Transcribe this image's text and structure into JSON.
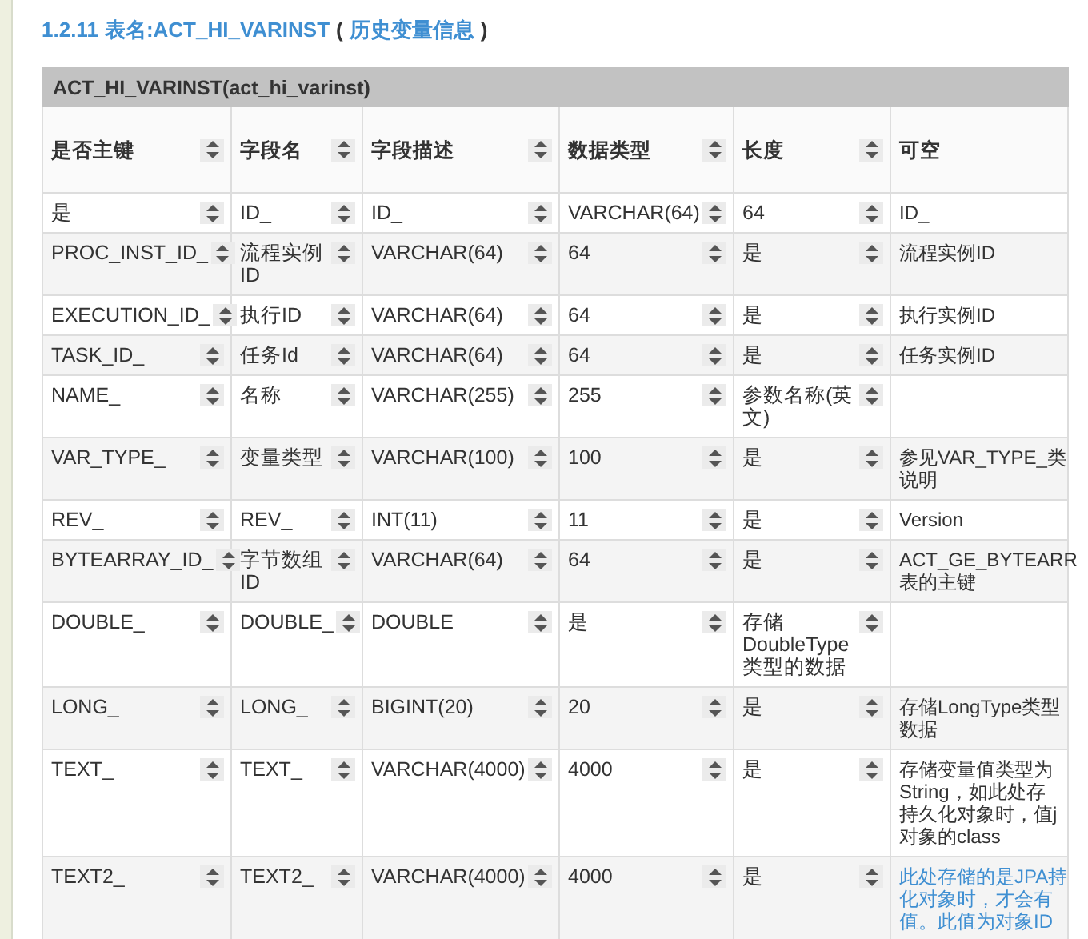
{
  "heading": {
    "number": "1.2.11",
    "label": "表名:ACT_HI_VARINST",
    "open": "(",
    "note": "历史变量信息",
    "close": ")"
  },
  "table": {
    "caption": "ACT_HI_VARINST(act_hi_varinst)",
    "columns": [
      "是否主键",
      "字段名",
      "字段描述",
      "数据类型",
      "长度",
      "可空"
    ],
    "rows": [
      {
        "cells": [
          "是",
          "ID_",
          "ID_",
          "VARCHAR(64)",
          "64"
        ],
        "last": {
          "kind": "text",
          "lines": [
            "ID_"
          ]
        }
      },
      {
        "cells": [
          "PROC_INST_ID_",
          "流程实例ID",
          "VARCHAR(64)",
          "64",
          "是"
        ],
        "last": {
          "kind": "text",
          "lines": [
            "流程实例ID"
          ]
        }
      },
      {
        "cells": [
          "EXECUTION_ID_",
          "执行ID",
          "VARCHAR(64)",
          "64",
          "是"
        ],
        "last": {
          "kind": "text",
          "lines": [
            "执行实例ID"
          ]
        }
      },
      {
        "cells": [
          "TASK_ID_",
          "任务Id",
          "VARCHAR(64)",
          "64",
          "是"
        ],
        "last": {
          "kind": "text",
          "lines": [
            "任务实例ID"
          ]
        }
      },
      {
        "cells": [
          "NAME_",
          "名称",
          "VARCHAR(255)",
          "255",
          "参数名称(英文)"
        ]
      },
      {
        "cells": [
          "VAR_TYPE_",
          "变量类型",
          "VARCHAR(100)",
          "100",
          "是"
        ],
        "last": {
          "kind": "text",
          "lines": [
            "参见VAR_TYPE_类",
            "说明"
          ]
        }
      },
      {
        "cells": [
          "REV_",
          "REV_",
          "INT(11)",
          "11",
          "是"
        ],
        "last": {
          "kind": "text",
          "lines": [
            "Version"
          ]
        }
      },
      {
        "cells": [
          "BYTEARRAY_ID_",
          "字节数组ID",
          "VARCHAR(64)",
          "64",
          "是"
        ],
        "last": {
          "kind": "text",
          "lines": [
            "ACT_GE_BYTEARR",
            "表的主键"
          ]
        }
      },
      {
        "cells": [
          "DOUBLE_",
          "DOUBLE_",
          "DOUBLE",
          "是",
          "存储DoubleType类型的数据"
        ]
      },
      {
        "cells": [
          "LONG_",
          "LONG_",
          "BIGINT(20)",
          "20",
          "是"
        ],
        "last": {
          "kind": "text",
          "lines": [
            "存储LongType类型",
            "数据"
          ]
        }
      },
      {
        "cells": [
          "TEXT_",
          "TEXT_",
          "VARCHAR(4000)",
          "4000",
          "是"
        ],
        "last": {
          "kind": "text",
          "lines": [
            "存储变量值类型为",
            "String，如此处存",
            "持久化对象时，值j",
            "对象的class"
          ]
        }
      },
      {
        "cells": [
          "TEXT2_",
          "TEXT2_",
          "VARCHAR(4000)",
          "4000",
          "是"
        ],
        "last": {
          "kind": "link",
          "lines": [
            "此处存储的是JPA持",
            "化对象时，才会有",
            "值。此值为对象ID"
          ]
        }
      }
    ]
  }
}
